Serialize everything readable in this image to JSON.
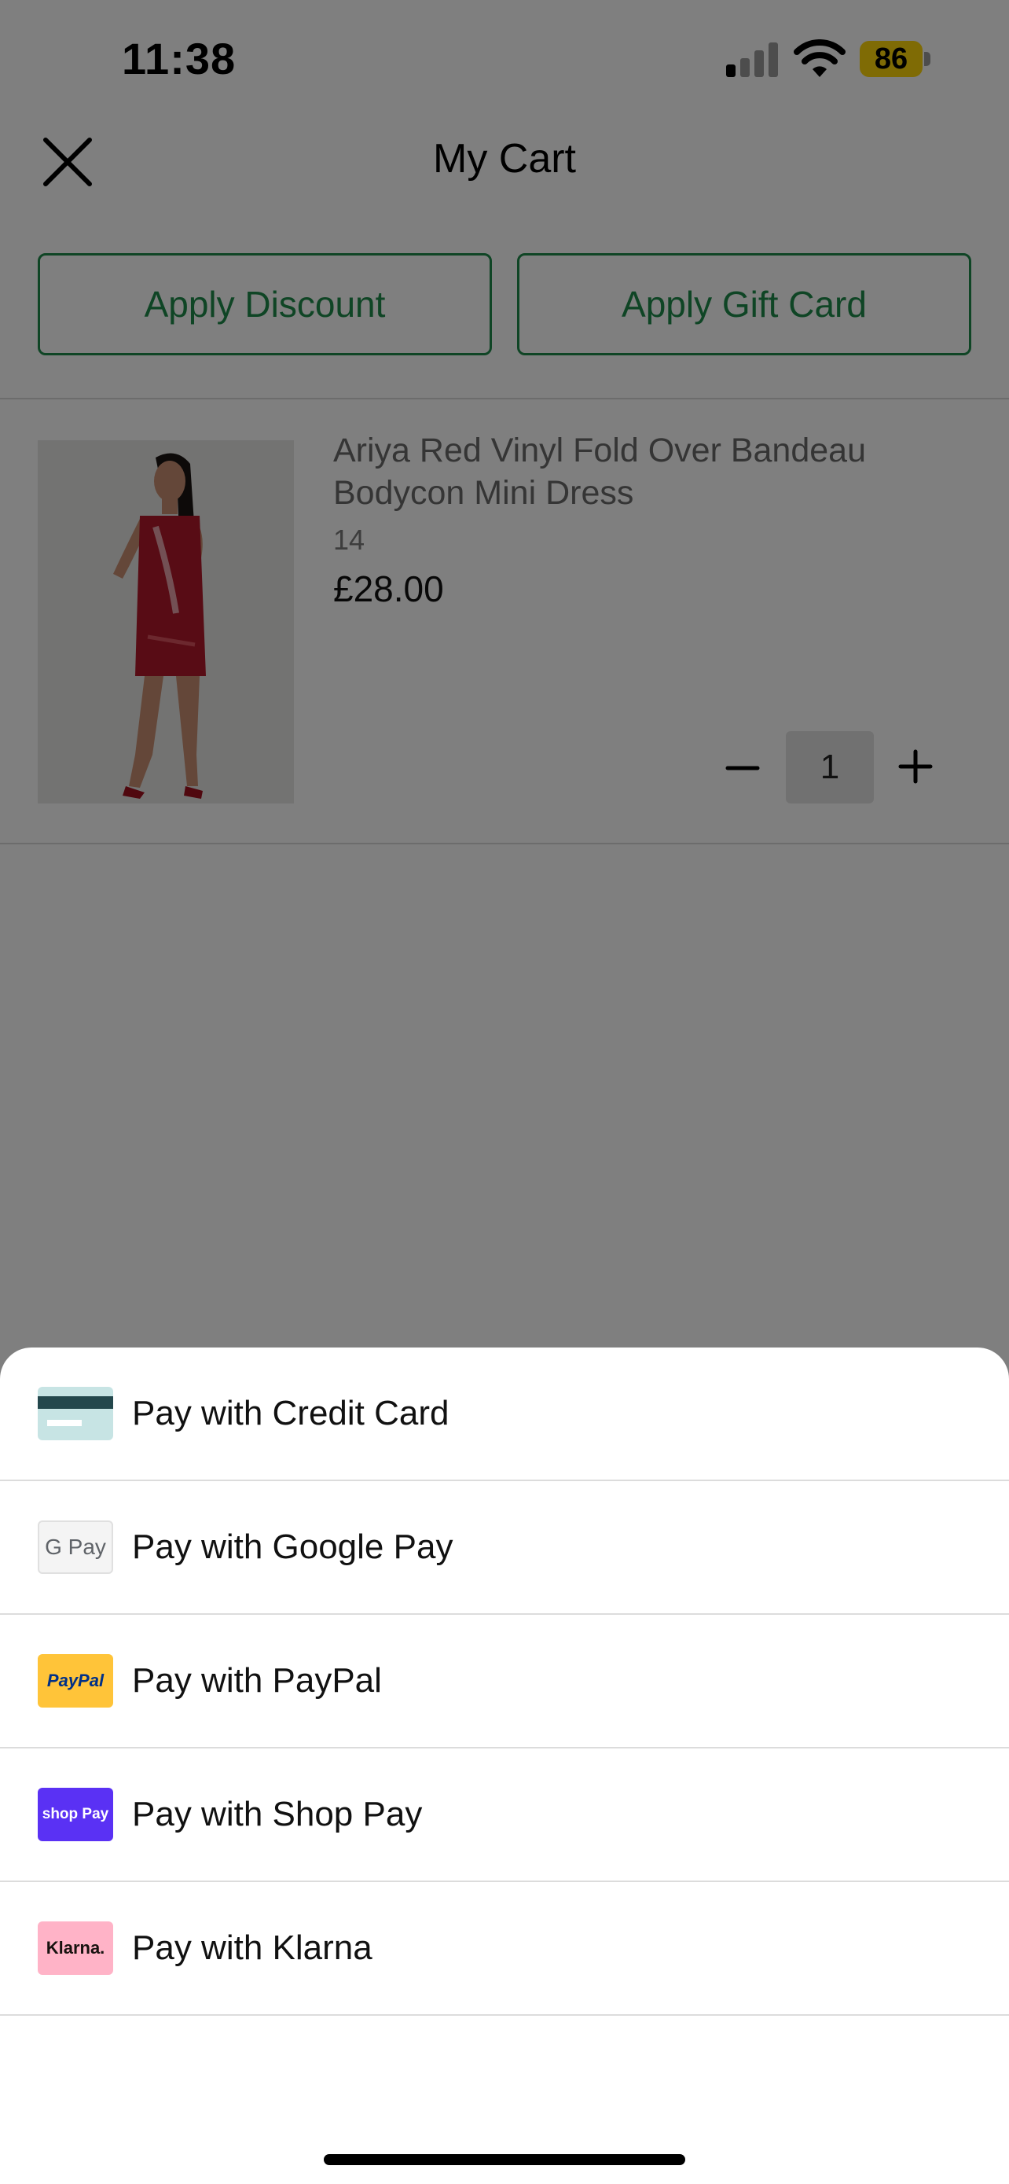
{
  "status_bar": {
    "time": "11:38",
    "battery": "86"
  },
  "header": {
    "title": "My Cart"
  },
  "actions": {
    "discount_label": "Apply Discount",
    "gift_card_label": "Apply Gift Card"
  },
  "cart_item": {
    "name": "Ariya Red Vinyl Fold Over Bandeau Bodycon Mini Dress",
    "size": "14",
    "price": "£28.00",
    "quantity": "1"
  },
  "payment_options": [
    {
      "label": "Pay with Credit Card",
      "icon": "credit-card-icon"
    },
    {
      "label": "Pay with Google Pay",
      "icon": "google-pay-icon",
      "icon_text": "G Pay"
    },
    {
      "label": "Pay with PayPal",
      "icon": "paypal-icon",
      "icon_text": "PayPal"
    },
    {
      "label": "Pay with Shop Pay",
      "icon": "shop-pay-icon",
      "icon_text": "shop Pay"
    },
    {
      "label": "Pay with Klarna",
      "icon": "klarna-icon",
      "icon_text": "Klarna."
    }
  ],
  "colors": {
    "accent": "#1e8a4a",
    "battery": "#ffd60a",
    "shop_pay": "#5a31f4",
    "paypal": "#ffc439",
    "klarna": "#ffb3c7"
  }
}
